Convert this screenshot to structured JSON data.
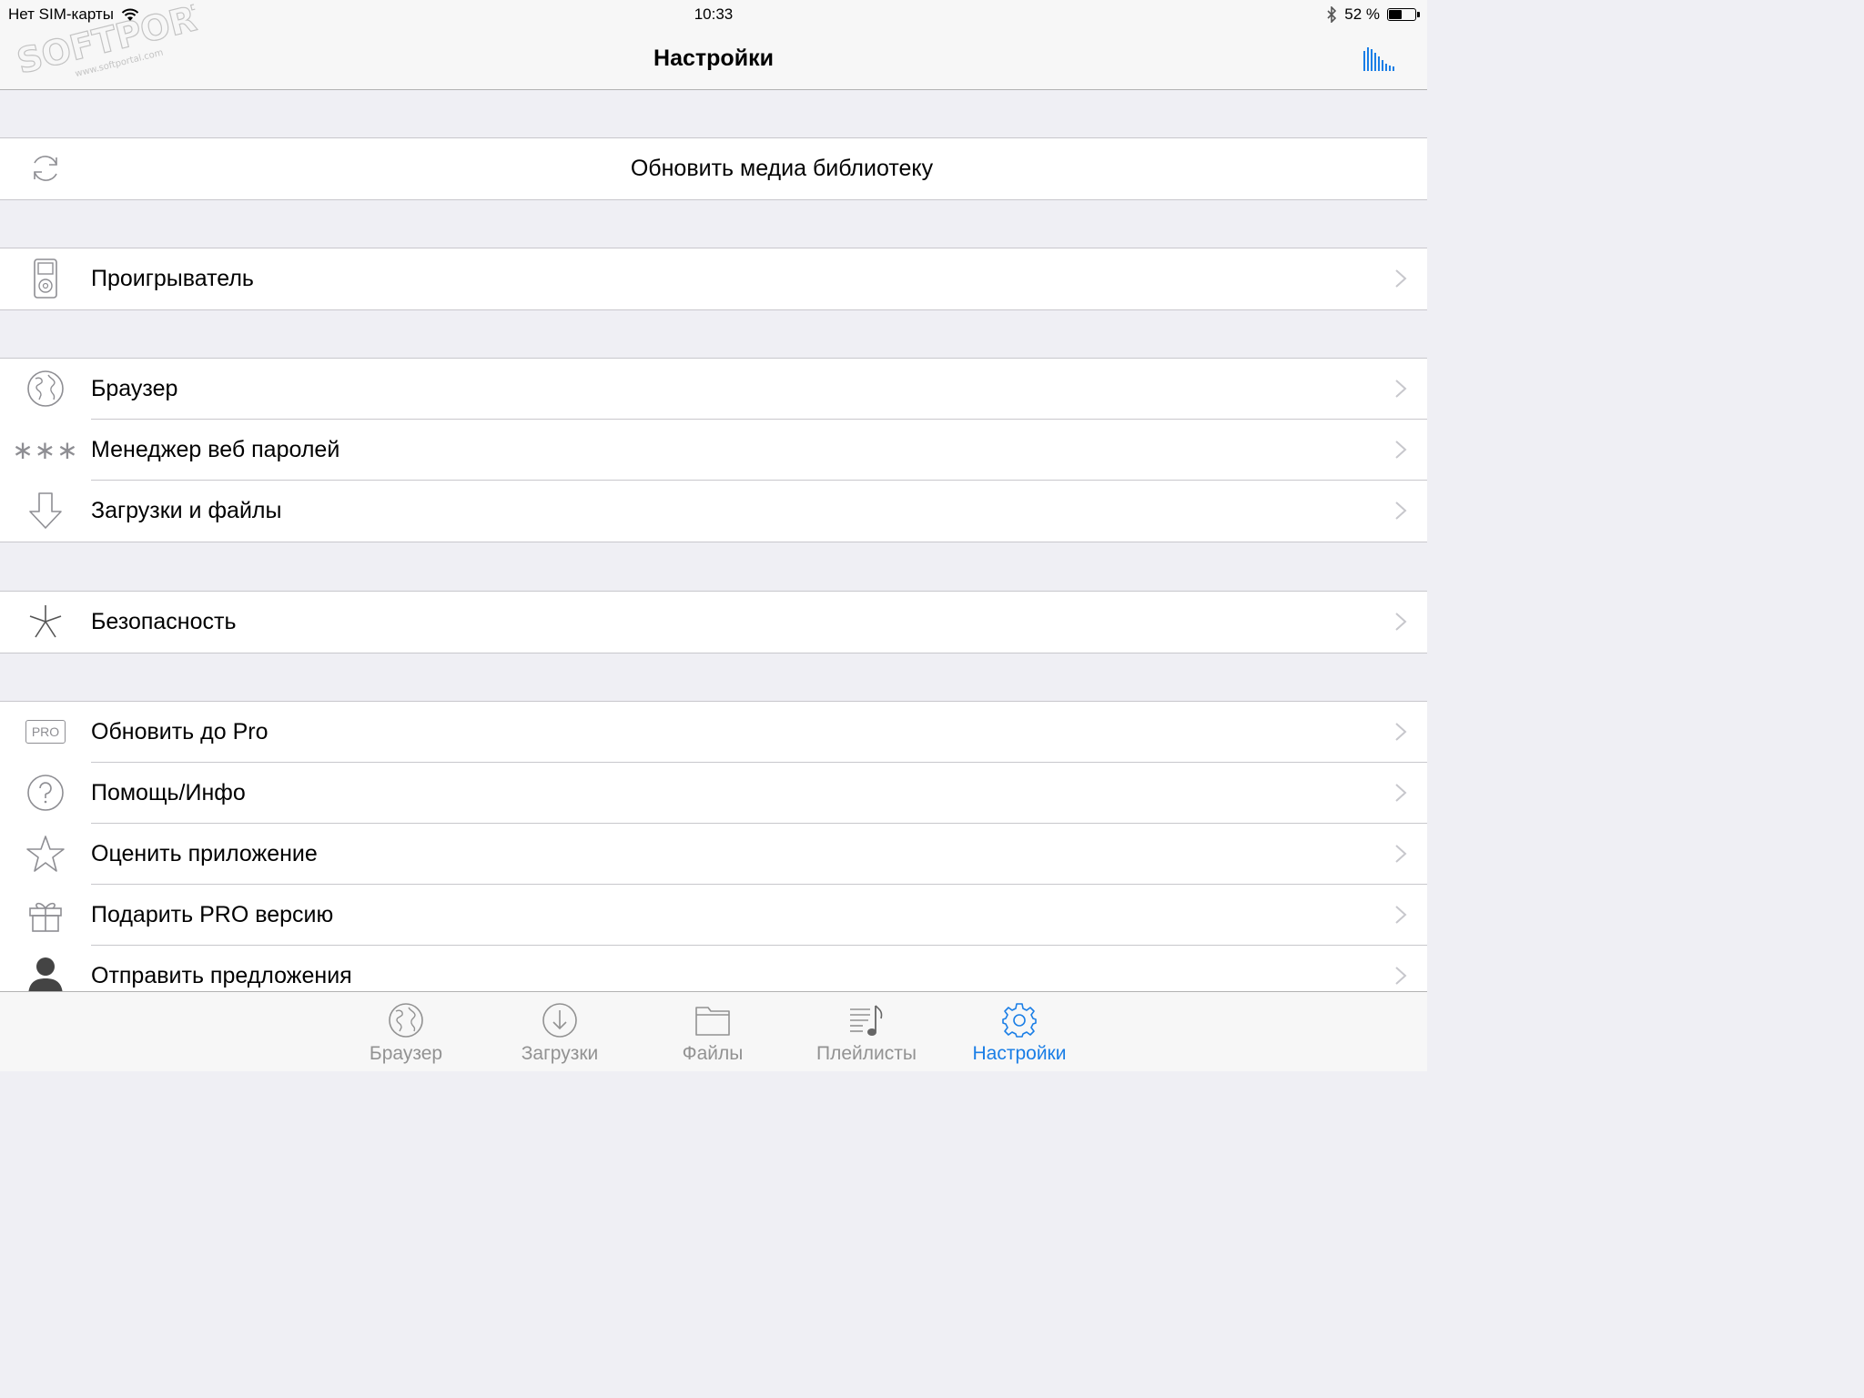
{
  "status_bar": {
    "carrier": "Нет SIM-карты",
    "time": "10:33",
    "battery_percent": "52 %",
    "battery_level": 0.52
  },
  "nav": {
    "title": "Настройки",
    "right_icon": "equalizer-icon"
  },
  "watermark": {
    "brand": "SOFTPORTAL",
    "url": "www.softportal.com"
  },
  "groups": [
    {
      "rows": [
        {
          "icon": "refresh-icon",
          "label": "Обновить медиа библиотеку",
          "centered": true,
          "chevron": false
        }
      ]
    },
    {
      "rows": [
        {
          "icon": "player-icon",
          "label": "Проигрыватель",
          "chevron": true
        }
      ]
    },
    {
      "rows": [
        {
          "icon": "globe-icon",
          "label": "Браузер",
          "chevron": true
        },
        {
          "icon": "password-asterisks-icon",
          "label": "Менеджер веб паролей",
          "chevron": true
        },
        {
          "icon": "download-arrow-icon",
          "label": "Загрузки и файлы",
          "chevron": true
        }
      ]
    },
    {
      "rows": [
        {
          "icon": "asterisk-icon",
          "label": "Безопасность",
          "chevron": true
        }
      ]
    },
    {
      "rows": [
        {
          "icon": "pro-badge-icon",
          "icon_text": "PRO",
          "label": "Обновить до Pro",
          "chevron": true
        },
        {
          "icon": "question-icon",
          "label": "Помощь/Инфо",
          "chevron": true
        },
        {
          "icon": "star-icon",
          "label": "Оценить приложение",
          "chevron": true
        },
        {
          "icon": "gift-icon",
          "label": "Подарить PRO версию",
          "chevron": true
        },
        {
          "icon": "person-icon",
          "label": "Отправить предложения",
          "chevron": true
        }
      ]
    }
  ],
  "tabs": [
    {
      "label": "Браузер",
      "icon": "globe-icon",
      "active": false
    },
    {
      "label": "Загрузки",
      "icon": "download-circle-icon",
      "active": false
    },
    {
      "label": "Файлы",
      "icon": "folder-icon",
      "active": false
    },
    {
      "label": "Плейлисты",
      "icon": "playlist-icon",
      "active": false
    },
    {
      "label": "Настройки",
      "icon": "gear-icon",
      "active": true
    }
  ],
  "colors": {
    "accent": "#1a7ee6",
    "background": "#efeff4",
    "separator": "#c8c7cc",
    "icon_gray": "#8e8e93"
  }
}
